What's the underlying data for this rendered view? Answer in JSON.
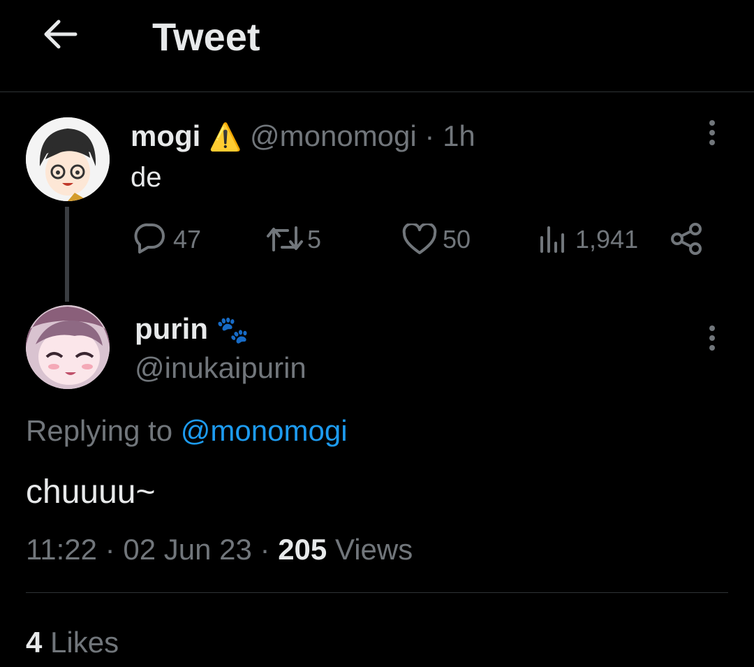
{
  "header": {
    "title": "Tweet",
    "back_icon": "arrow-left-icon"
  },
  "parent_tweet": {
    "author_name": "mogi",
    "badge": "⚠️",
    "handle": "@monomogi",
    "separator": "·",
    "time": "1h",
    "text": "de",
    "stats": {
      "replies": "47",
      "retweets": "5",
      "likes": "50",
      "views": "1,941"
    }
  },
  "reply_tweet": {
    "author_name": "purin",
    "badge": "🐾",
    "handle": "@inukaipurin",
    "replying_to_label": "Replying to",
    "replying_to_handle": "@monomogi",
    "text": "chuuuu~",
    "time": "11:22",
    "sep1": "·",
    "date": "02 Jun 23",
    "sep2": "·",
    "views_count": "205",
    "views_label": "Views",
    "likes_count": "4",
    "likes_label": "Likes"
  },
  "colors": {
    "background": "#000000",
    "text": "#e7e9ea",
    "muted": "#71767b",
    "link": "#1d9bf0",
    "divider": "#2f3336"
  }
}
